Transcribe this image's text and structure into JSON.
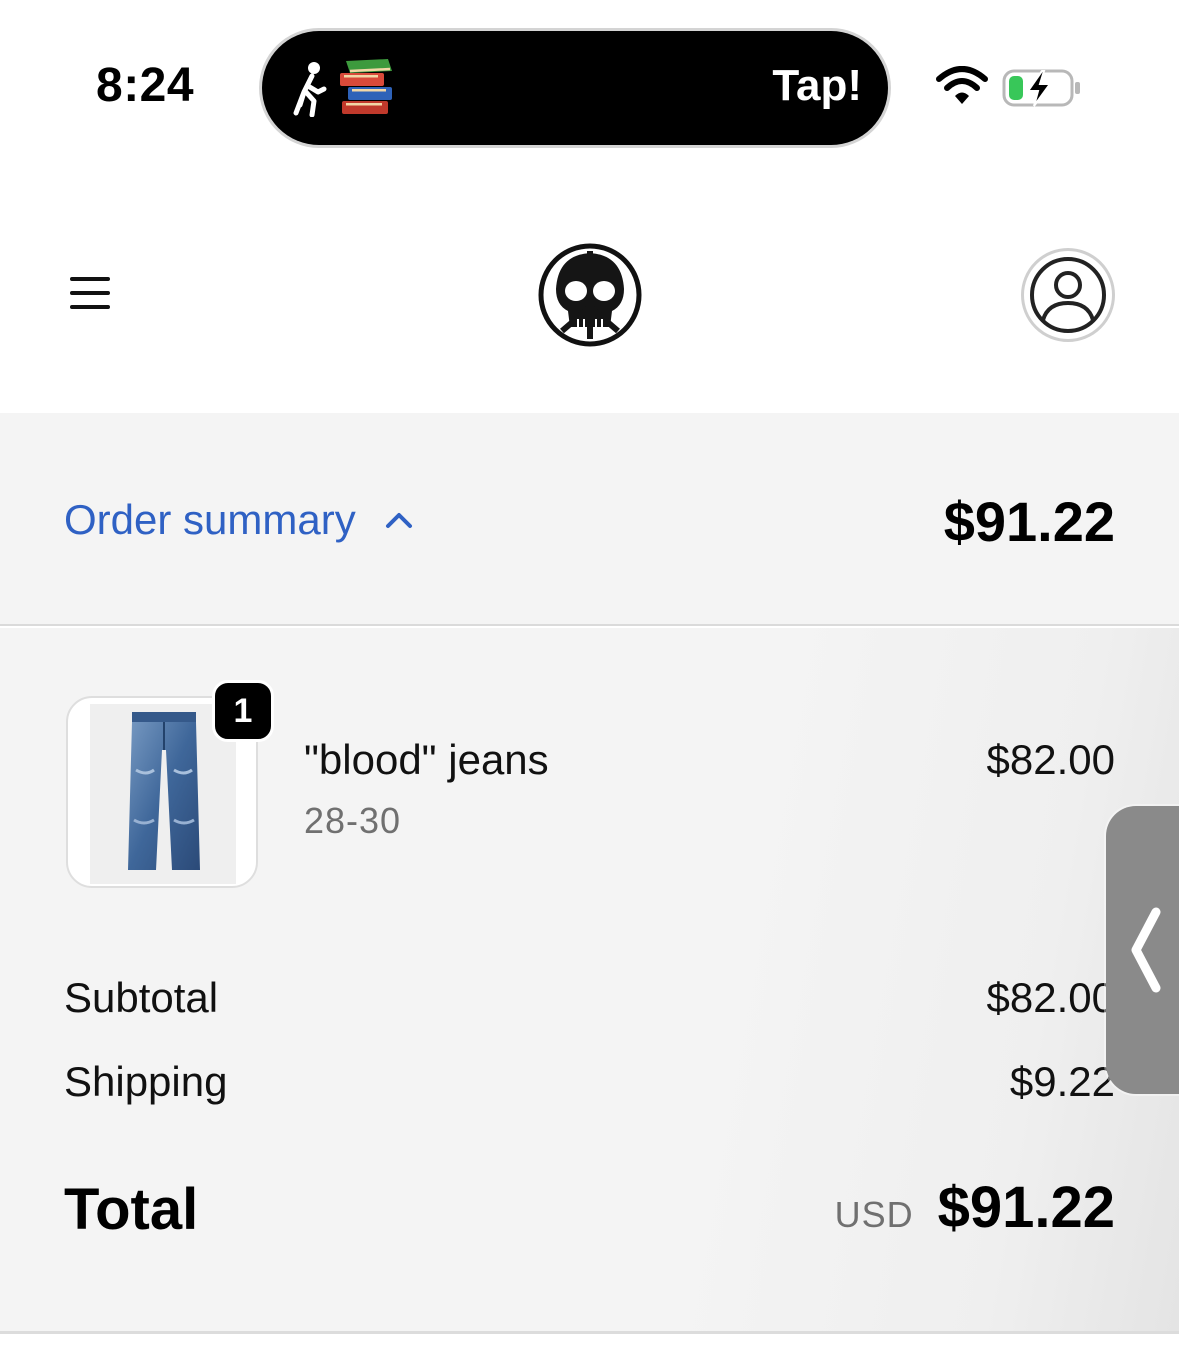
{
  "status_bar": {
    "time": "8:24",
    "live_activity_text": "Tap!",
    "icons": [
      "walking-person-icon",
      "books-icon",
      "wifi-icon",
      "battery-charging-icon"
    ]
  },
  "header": {
    "icons": [
      "hamburger-menu-icon",
      "skull-peace-logo",
      "account-icon"
    ]
  },
  "order_summary": {
    "toggle_label": "Order summary",
    "toggle_state": "expanded",
    "total": "$91.22"
  },
  "line_items": [
    {
      "name": "\"blood\" jeans",
      "variant": "28-30",
      "price": "$82.00",
      "quantity": "1"
    }
  ],
  "totals": {
    "subtotal_label": "Subtotal",
    "subtotal_value": "$82.00",
    "shipping_label": "Shipping",
    "shipping_value": "$9.22",
    "total_label": "Total",
    "currency": "USD",
    "total_value": "$91.22"
  },
  "colors": {
    "accent_link": "#2f61c4",
    "summary_background": "#f4f4f4",
    "text_primary": "#111111",
    "text_muted": "#707070"
  }
}
